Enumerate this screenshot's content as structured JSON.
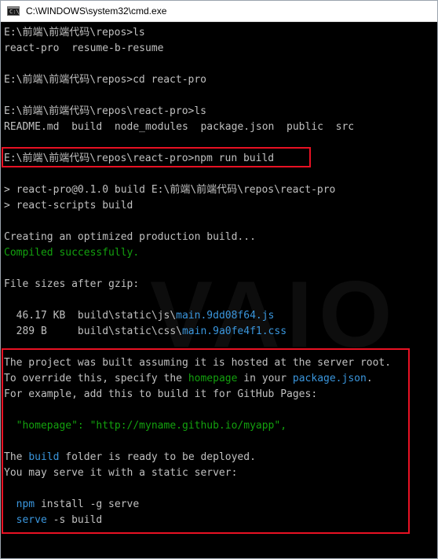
{
  "window": {
    "title": "C:\\WINDOWS\\system32\\cmd.exe"
  },
  "console": {
    "lines": [
      [
        {
          "t": "E:\\前端\\前端代码\\repos>ls"
        }
      ],
      [
        {
          "t": "react-pro  resume-b-resume"
        }
      ],
      [
        {
          "t": ""
        }
      ],
      [
        {
          "t": "E:\\前端\\前端代码\\repos>cd react-pro"
        }
      ],
      [
        {
          "t": ""
        }
      ],
      [
        {
          "t": "E:\\前端\\前端代码\\repos\\react-pro>ls"
        }
      ],
      [
        {
          "t": "README.md  build  node_modules  package.json  public  src"
        }
      ],
      [
        {
          "t": ""
        }
      ],
      [
        {
          "t": "E:\\前端\\前端代码\\repos\\react-pro>npm run build"
        }
      ],
      [
        {
          "t": ""
        }
      ],
      [
        {
          "t": "> react-pro@0.1.0 build E:\\前端\\前端代码\\repos\\react-pro"
        }
      ],
      [
        {
          "t": "> react-scripts build"
        }
      ],
      [
        {
          "t": ""
        }
      ],
      [
        {
          "t": "Creating an optimized production build..."
        }
      ],
      [
        {
          "t": "Compiled successfully.",
          "c": "green"
        }
      ],
      [
        {
          "t": ""
        }
      ],
      [
        {
          "t": "File sizes after gzip:"
        }
      ],
      [
        {
          "t": ""
        }
      ],
      [
        {
          "t": "  46.17 KB  build\\static\\js\\"
        },
        {
          "t": "main.9dd08f64.js",
          "c": "cyan"
        }
      ],
      [
        {
          "t": "  289 B     build\\static\\css\\"
        },
        {
          "t": "main.9a0fe4f1.css",
          "c": "cyan"
        }
      ],
      [
        {
          "t": ""
        }
      ],
      [
        {
          "t": "The project was built assuming it is hosted at the server root."
        }
      ],
      [
        {
          "t": "To override this, specify the "
        },
        {
          "t": "homepage",
          "c": "green"
        },
        {
          "t": " in your "
        },
        {
          "t": "package.json",
          "c": "cyan"
        },
        {
          "t": "."
        }
      ],
      [
        {
          "t": "For example, add this to build it for GitHub Pages:"
        }
      ],
      [
        {
          "t": ""
        }
      ],
      [
        {
          "t": "  \"homepage\": \"http://myname.github.io/myapp\",",
          "c": "green"
        }
      ],
      [
        {
          "t": ""
        }
      ],
      [
        {
          "t": "The "
        },
        {
          "t": "build",
          "c": "cyan"
        },
        {
          "t": " folder is ready to be deployed."
        }
      ],
      [
        {
          "t": "You may serve it with a static server:"
        }
      ],
      [
        {
          "t": ""
        }
      ],
      [
        {
          "t": "  "
        },
        {
          "t": "npm",
          "c": "cyan"
        },
        {
          "t": " install -g serve"
        }
      ],
      [
        {
          "t": "  "
        },
        {
          "t": "serve",
          "c": "cyan"
        },
        {
          "t": " -s build"
        }
      ]
    ]
  },
  "watermark": "VAIO",
  "colors": {
    "background": "#000000",
    "text": "#c0c0c0",
    "green": "#13a10e",
    "cyan": "#3a96dd",
    "highlight_border": "#e81123"
  }
}
